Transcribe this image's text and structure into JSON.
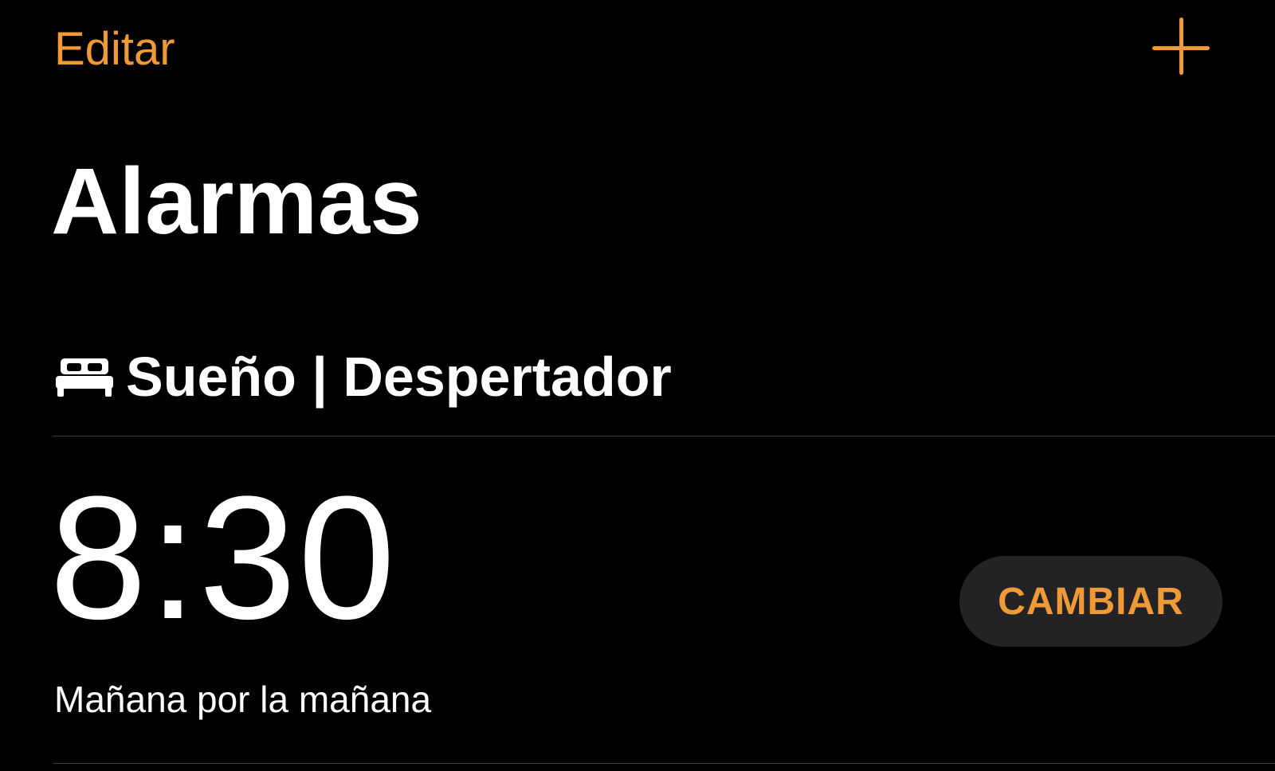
{
  "nav": {
    "edit_label": "Editar",
    "add_icon": "plus-icon"
  },
  "title": "Alarmas",
  "section": {
    "icon": "bed-icon",
    "label": "Sueño | Despertador"
  },
  "alarm": {
    "time": "8:30",
    "subtitle": "Mañana por la mañana",
    "change_label": "CAMBIAR"
  },
  "colors": {
    "accent": "#f09a37",
    "background": "#000000",
    "text": "#ffffff",
    "button_bg": "#232325",
    "separator": "#3a3a3c"
  }
}
